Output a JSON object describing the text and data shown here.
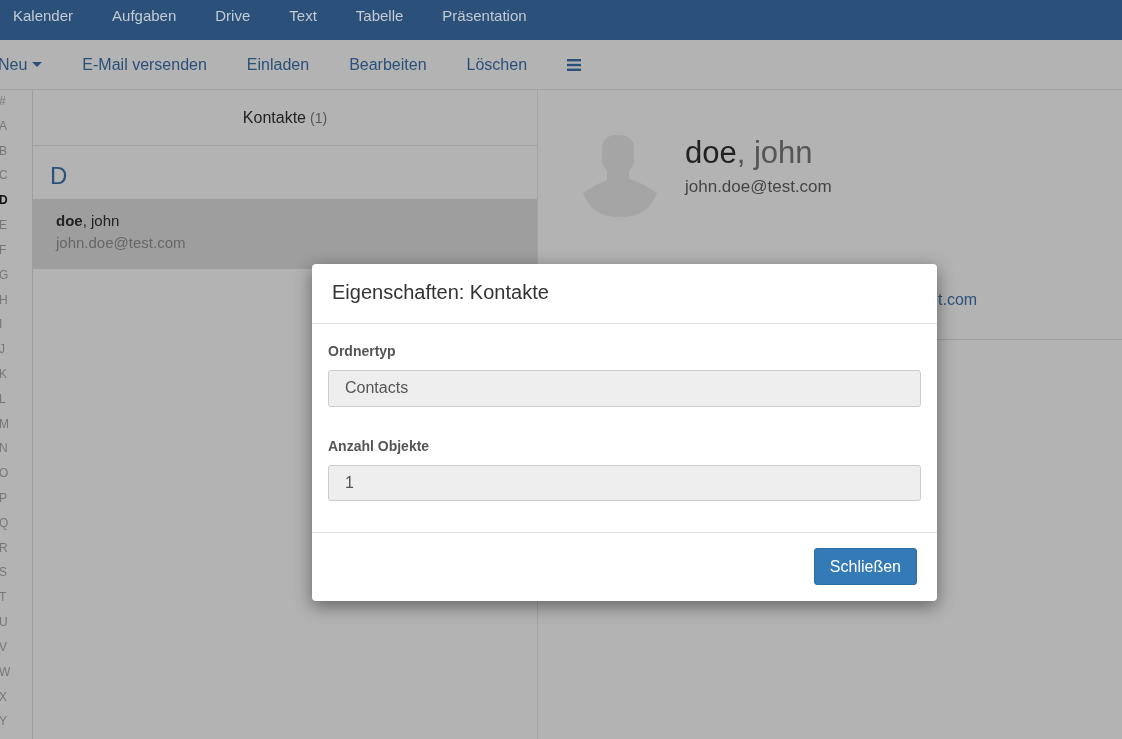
{
  "top_nav": {
    "items": [
      {
        "label": "Kalender"
      },
      {
        "label": "Aufgaben"
      },
      {
        "label": "Drive"
      },
      {
        "label": "Text"
      },
      {
        "label": "Tabelle"
      },
      {
        "label": "Präsentation"
      }
    ]
  },
  "toolbar": {
    "items": [
      {
        "kind": "dropdown",
        "label": "Neu"
      },
      {
        "kind": "button",
        "label": "E-Mail versenden"
      },
      {
        "kind": "button",
        "label": "Einladen"
      },
      {
        "kind": "button",
        "label": "Bearbeiten"
      },
      {
        "kind": "button",
        "label": "Löschen"
      },
      {
        "kind": "menu"
      }
    ]
  },
  "alphabet_index": [
    {
      "label": "#",
      "selected": false
    },
    {
      "label": "A",
      "selected": false
    },
    {
      "label": "B",
      "selected": false
    },
    {
      "label": "C",
      "selected": false
    },
    {
      "label": "D",
      "selected": true
    },
    {
      "label": "E",
      "selected": false
    },
    {
      "label": "F",
      "selected": false
    },
    {
      "label": "G",
      "selected": false
    },
    {
      "label": "H",
      "selected": false
    },
    {
      "label": "I",
      "selected": false
    },
    {
      "label": "J",
      "selected": false
    },
    {
      "label": "K",
      "selected": false
    },
    {
      "label": "L",
      "selected": false
    },
    {
      "label": "M",
      "selected": false
    },
    {
      "label": "N",
      "selected": false
    },
    {
      "label": "O",
      "selected": false
    },
    {
      "label": "P",
      "selected": false
    },
    {
      "label": "Q",
      "selected": false
    },
    {
      "label": "R",
      "selected": false
    },
    {
      "label": "S",
      "selected": false
    },
    {
      "label": "T",
      "selected": false
    },
    {
      "label": "U",
      "selected": false
    },
    {
      "label": "V",
      "selected": false
    },
    {
      "label": "W",
      "selected": false
    },
    {
      "label": "X",
      "selected": false
    },
    {
      "label": "Y",
      "selected": false
    }
  ],
  "contact_list": {
    "title": "Kontakte",
    "count": "(1)",
    "groups": [
      {
        "letter": "D",
        "contacts": [
          {
            "name": "**doe**, john",
            "email": "john.doe@test.com",
            "selected": true
          }
        ]
      }
    ]
  },
  "detail": {
    "name": "**doe**, john",
    "email": "john.doe@test.com",
    "link_fragment": "t.com"
  },
  "dialog": {
    "title": "Eigenschaften: Kontakte",
    "fields": [
      {
        "label": "Ordnertyp",
        "value": "Contacts"
      },
      {
        "label": "Anzahl Objekte",
        "value": "1"
      }
    ],
    "buttons": [
      {
        "label": "Schließen",
        "kind": "primary"
      }
    ]
  }
}
